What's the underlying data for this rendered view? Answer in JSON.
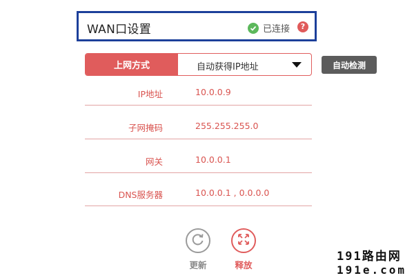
{
  "header": {
    "title": "WAN口设置",
    "status_text": "已连接",
    "help_glyph": "?",
    "status_icon": "check-circle-icon",
    "status_color": "#5cb85c",
    "help_color": "#e05a5a",
    "border_color": "#1c3f9a"
  },
  "connection": {
    "label": "上网方式",
    "value": "自动获得IP地址",
    "auto_detect_label": "自动检测",
    "accent_color": "#e05c5c"
  },
  "fields": [
    {
      "label": "IP地址",
      "value": "10.0.0.9"
    },
    {
      "label": "子网掩码",
      "value": "255.255.255.0"
    },
    {
      "label": "网关",
      "value": "10.0.0.1"
    },
    {
      "label": "DNS服务器",
      "value": "10.0.0.1 , 0.0.0.0"
    }
  ],
  "actions": {
    "refresh_label": "更新",
    "release_label": "释放",
    "refresh_icon": "refresh-icon",
    "release_icon": "release-arrows-icon"
  },
  "watermark": {
    "line1": "191路由网",
    "line2": "191e.com"
  }
}
